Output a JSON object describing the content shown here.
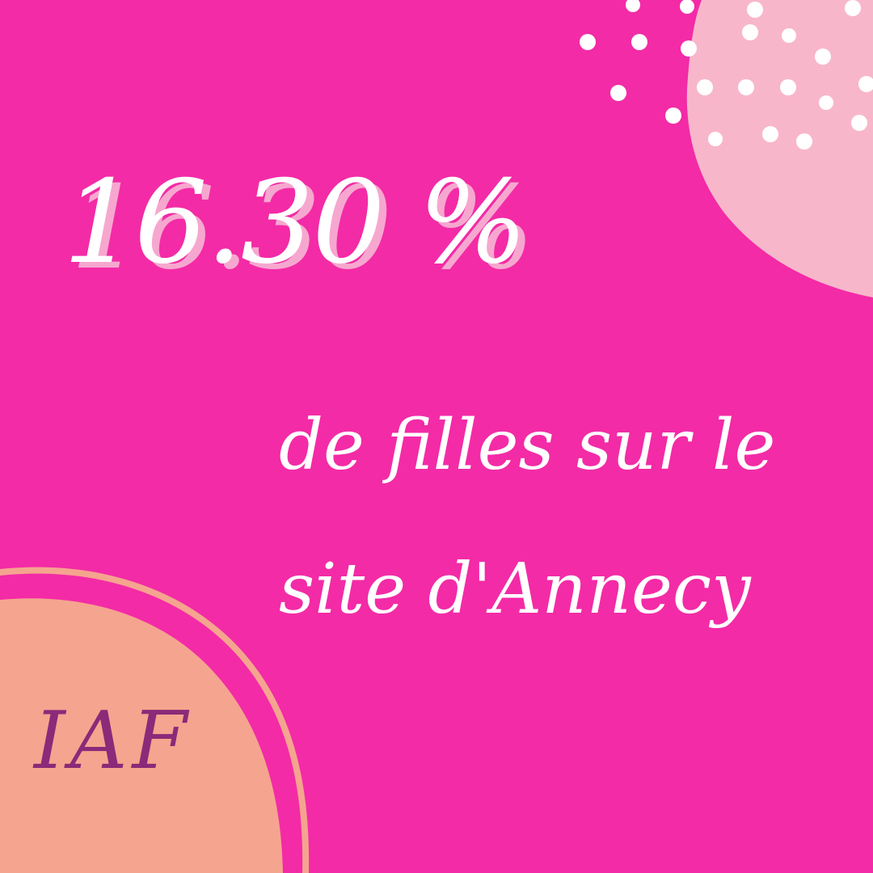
{
  "background_color": "#f32ba6",
  "accent_colors": {
    "pink_blob": "#f8b6cb",
    "peach_blob": "#f5a48f",
    "dots": "#ffffff",
    "logo_text": "#8a2a79"
  },
  "headline": {
    "stat": "16.30 %",
    "line_1": "de filles sur le",
    "line_2": "site d'Annecy"
  },
  "logo": {
    "text": "IAF"
  }
}
